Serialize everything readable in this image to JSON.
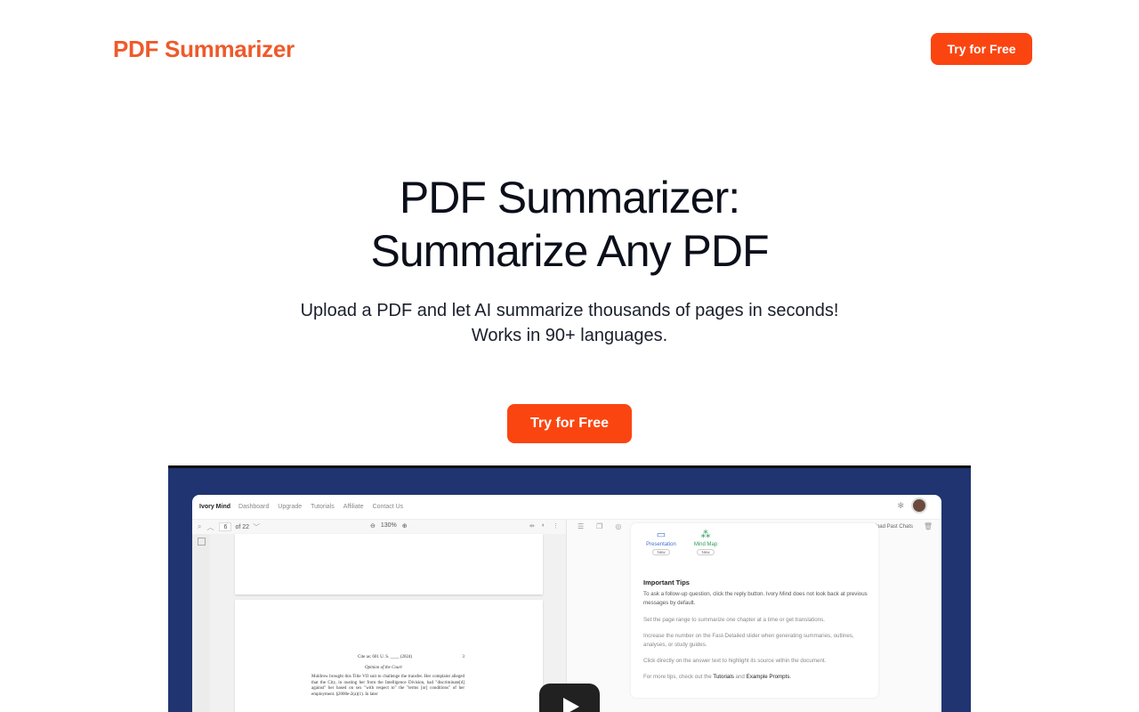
{
  "header": {
    "logo": "PDF Summarizer",
    "cta_label": "Try for Free"
  },
  "hero": {
    "title_line1": "PDF Summarizer:",
    "title_line2": "Summarize Any PDF",
    "subtitle_line1": "Upload a PDF and let AI summarize thousands of pages in seconds!",
    "subtitle_line2": "Works in 90+ languages.",
    "cta_label": "Try for Free"
  },
  "video": {
    "app": {
      "nav": {
        "brand": "Ivory Mind",
        "items": [
          "Dashboard",
          "Upgrade",
          "Tutorials",
          "Affiliate",
          "Contact Us"
        ]
      },
      "viewer": {
        "page_current": "6",
        "page_total": "of 22",
        "zoom": "130%",
        "page": {
          "citation": "Cite as: 601 U. S. ____ (2024)",
          "page_number": "3",
          "heading": "Opinion of the Court",
          "body": "Muldrow brought this Title VII suit to challenge the transfer. Her complaint alleged that the City, in ousting her from the Intelligence Division, had \"discriminate[d] against\" her based on sex \"with respect to\" the \"terms [or] conditions\" of her employment. §2000e-2(a)(1). In later"
        }
      },
      "chat": {
        "download_label": "Download Past Chats",
        "tiles": [
          {
            "label": "Presentation",
            "badge": "New"
          },
          {
            "label": "Mind Map",
            "badge": "New"
          }
        ],
        "tips_title": "Important Tips",
        "tips": [
          "To ask a follow-up question, click the reply button. Ivory Mind does not look back at previous messages by default.",
          "Set the page range to summarize one chapter at a time or get translations.",
          "Increase the number on the Fast-Detailed slider when generating summaries, outlines, analyses, or study guides.",
          "Click directly on the answer text to highlight its source within the document."
        ],
        "more_tips_prefix": "For more tips, check out the",
        "more_tips_link1": "Tutorials",
        "more_tips_and": "and",
        "more_tips_link2": "Example Prompts"
      }
    }
  },
  "colors": {
    "brand": "#ee5a2a",
    "button": "#fb4511",
    "video_bg": "#1f3470"
  },
  "icons": [
    "play-icon",
    "search-icon",
    "chevron-up-icon",
    "chevron-down-icon",
    "zoom-out-icon",
    "zoom-in-icon",
    "settings-icon",
    "presentation-icon",
    "mind-map-icon",
    "download-icon",
    "trash-icon"
  ]
}
